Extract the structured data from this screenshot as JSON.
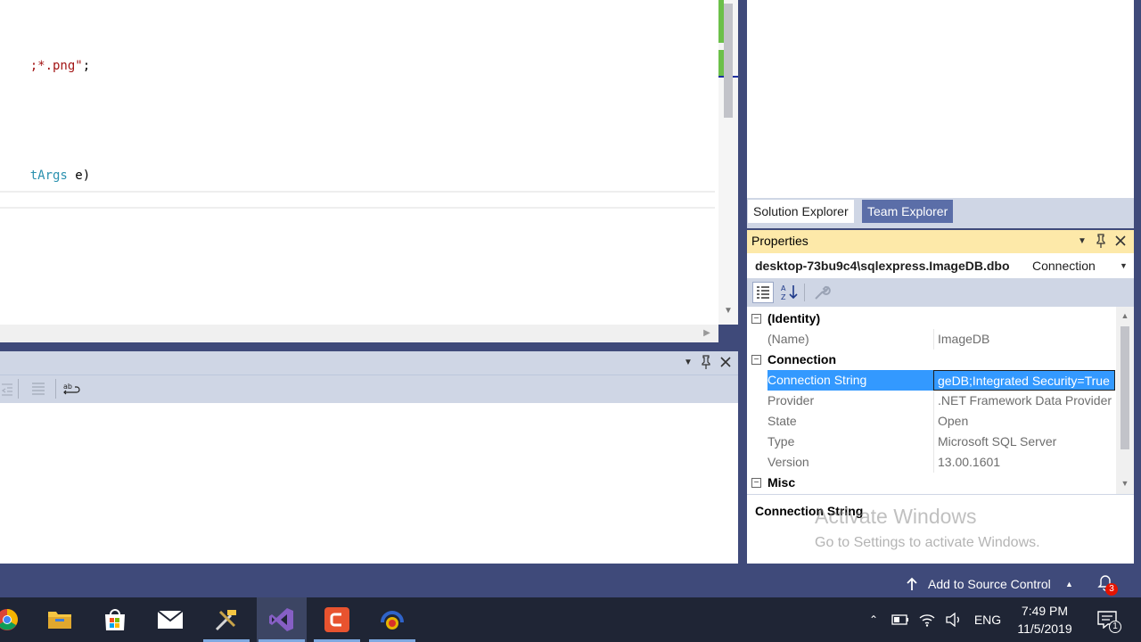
{
  "editor": {
    "lines": [
      {
        "parts": [
          {
            "t": ";*.png\"",
            "c": "str"
          },
          {
            "t": ";",
            "c": ""
          }
        ]
      },
      {
        "parts": [
          {
            "t": "tArgs",
            "c": "typ"
          },
          {
            "t": " e)",
            "c": ""
          }
        ]
      }
    ]
  },
  "right_tabs": [
    {
      "label": "Solution Explorer",
      "active": true
    },
    {
      "label": "Team Explorer",
      "active": false
    }
  ],
  "properties": {
    "title": "Properties",
    "object_name": "desktop-73bu9c4\\sqlexpress.ImageDB.dbo",
    "object_type": "Connection",
    "categories": [
      {
        "name": "(Identity)",
        "rows": [
          {
            "name": "(Name)",
            "value": "ImageDB"
          }
        ]
      },
      {
        "name": "Connection",
        "rows": [
          {
            "name": "Connection String",
            "value": "geDB;Integrated Security=True",
            "selected": true
          },
          {
            "name": "Provider",
            "value": ".NET Framework Data Provider"
          },
          {
            "name": "State",
            "value": "Open"
          },
          {
            "name": "Type",
            "value": "Microsoft SQL Server"
          },
          {
            "name": "Version",
            "value": "13.00.1601"
          }
        ]
      },
      {
        "name": "Misc",
        "rows": []
      }
    ],
    "description_title": "Connection String"
  },
  "watermark": {
    "line1": "Activate Windows",
    "line2": "Go to Settings to activate Windows."
  },
  "statusbar": {
    "source_control": "Add to Source Control",
    "notification_count": "3"
  },
  "taskbar": {
    "language": "ENG",
    "time": "7:49 PM",
    "date": "11/5/2019",
    "notification_badge": "1"
  },
  "colors": {
    "accent_selected": "#3399ff",
    "vs_frame": "#3f4a7a",
    "properties_title": "#fde9a9"
  }
}
